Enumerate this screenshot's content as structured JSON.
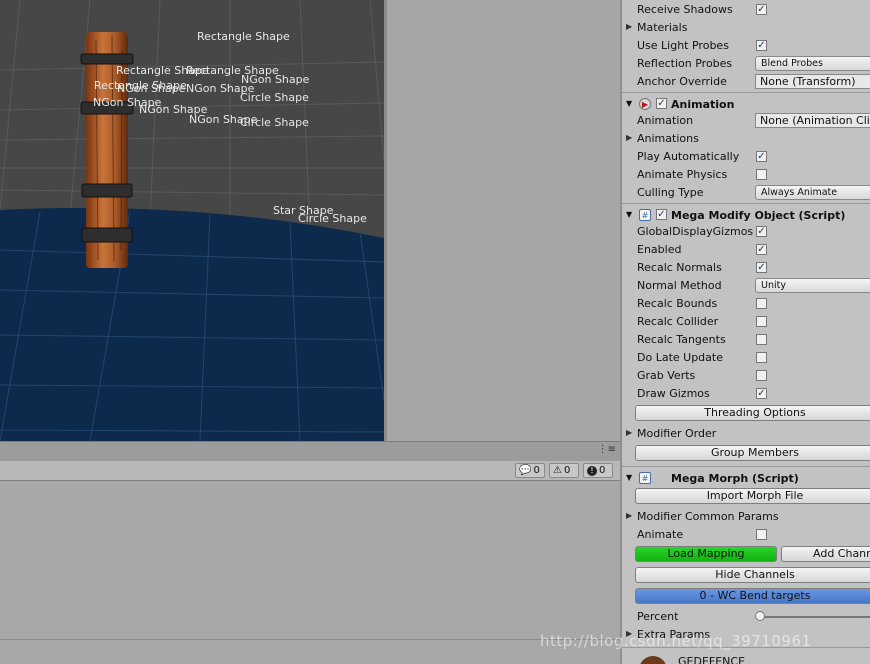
{
  "scene": {
    "labels": [
      "Rectangle Shape",
      "Rectangle Shape",
      "Rectangle Shape",
      "Rectangle Shape",
      "NGon Shape",
      "NGon Shape",
      "NGon Shape",
      "NGon Shape",
      "NGon Shape",
      "Circle Shape",
      "Circle Shape",
      "Circle Shape",
      "Star Shape",
      "Circle Shape"
    ]
  },
  "console": {
    "info_count": "0",
    "warn_count": "0",
    "error_count": "0"
  },
  "inspector": {
    "renderer": {
      "receive_shadows": "Receive Shadows",
      "materials": "Materials",
      "use_light_probes": "Use Light Probes",
      "reflection_probes": "Reflection Probes",
      "reflection_probes_value": "Blend Probes",
      "anchor_override": "Anchor Override",
      "anchor_override_value": "None (Transform)"
    },
    "animation": {
      "title": "Animation",
      "animation_label": "Animation",
      "animation_value": "None (Animation Clip)",
      "animations": "Animations",
      "play_automatically": "Play Automatically",
      "animate_physics": "Animate Physics",
      "culling_type": "Culling Type",
      "culling_value": "Always Animate"
    },
    "mega_modify": {
      "title": "Mega Modify Object (Script)",
      "global_gizmos": "GlobalDisplayGizmos",
      "enabled": "Enabled",
      "recalc_normals": "Recalc Normals",
      "normal_method": "Normal Method",
      "normal_method_value": "Unity",
      "recalc_bounds": "Recalc Bounds",
      "recalc_collider": "Recalc Collider",
      "recalc_tangents": "Recalc Tangents",
      "do_late_update": "Do Late Update",
      "grab_verts": "Grab Verts",
      "draw_gizmos": "Draw Gizmos",
      "threading_options": "Threading Options",
      "modifier_order": "Modifier Order",
      "group_members": "Group Members"
    },
    "mega_morph": {
      "title": "Mega Morph (Script)",
      "import_morph": "Import Morph File",
      "common_params": "Modifier Common Params",
      "animate": "Animate",
      "load_mapping": "Load Mapping",
      "add_channel": "Add Channel",
      "hide_channels": "Hide Channels",
      "channel": "0 - WC Bend targets",
      "percent": "Percent",
      "percent_value": 0,
      "extra_params": "Extra Params",
      "next_component": "GEDEFENCE"
    }
  },
  "watermark": "http://blog.csdn.net/qq_39710961",
  "colors": {
    "ground": "#0d2a4c",
    "load_mapping": "#1fc31f",
    "channel": "#5685d6"
  }
}
